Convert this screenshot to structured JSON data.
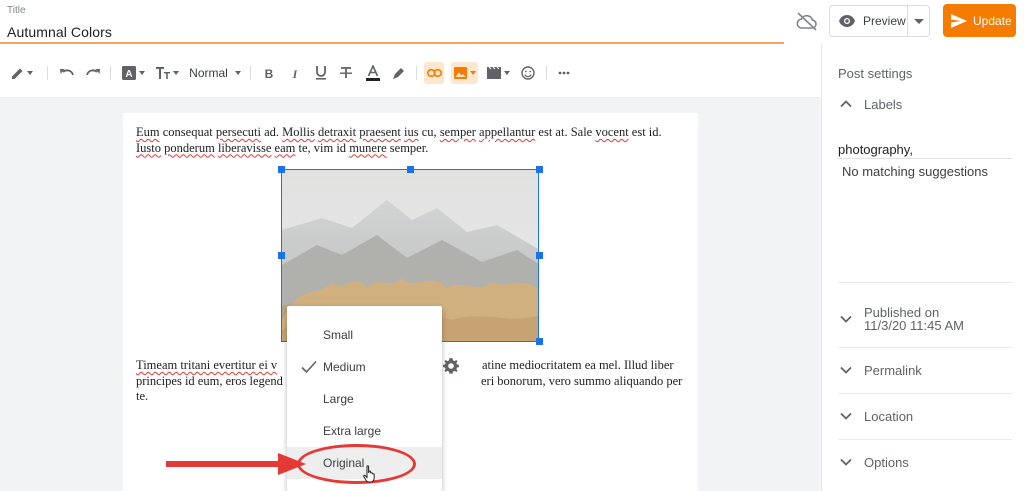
{
  "header": {
    "title_label": "Title",
    "title_value": "Autumnal Colors",
    "preview_label": "Preview",
    "update_label": "Update",
    "accent_color": "#f57c00"
  },
  "toolbar": {
    "icons": [
      "pen-icon",
      "undo-icon",
      "redo-icon",
      "text-color-icon",
      "font-size-icon",
      "bold-icon",
      "italic-icon",
      "underline-icon",
      "strikethrough-icon",
      "font-color-icon",
      "highlighter-icon",
      "link-icon",
      "image-icon",
      "video-icon",
      "emoji-icon",
      "more-icon"
    ],
    "paragraph_style": "Normal"
  },
  "editor": {
    "para1_parts": [
      "Eum",
      " consequat ",
      "persecuti",
      " ad. ",
      "Mollis",
      " ",
      "detraxit",
      " ",
      "praesent",
      " ",
      "ius",
      " cu, ",
      "semper",
      " ",
      "appellantur",
      " est at. Sale ",
      "vocent",
      " est id. ",
      "Iusto",
      " ",
      "ponderum",
      " ",
      "liberavisse",
      " ",
      "eam",
      " te, vim id ",
      "munere",
      " semper."
    ],
    "para2_lines": [
      "Timeam tritani evertitur ei v",
      "atine mediocritatem ea mel. Illud liber",
      "principes id eum, eros legend",
      "eri bonorum, vero summo aliquando per",
      "te."
    ]
  },
  "size_menu": {
    "items": [
      "Small",
      "Medium",
      "Large",
      "Extra large",
      "Original"
    ],
    "selected": "Medium",
    "hovered": "Original"
  },
  "sidebar": {
    "heading": "Post settings",
    "labels_title": "Labels",
    "labels_value": "photography,",
    "labels_suggestion": "No matching suggestions",
    "published_title": "Published on",
    "published_date": "11/3/20 11:45 AM",
    "permalink": "Permalink",
    "location": "Location",
    "options": "Options"
  }
}
